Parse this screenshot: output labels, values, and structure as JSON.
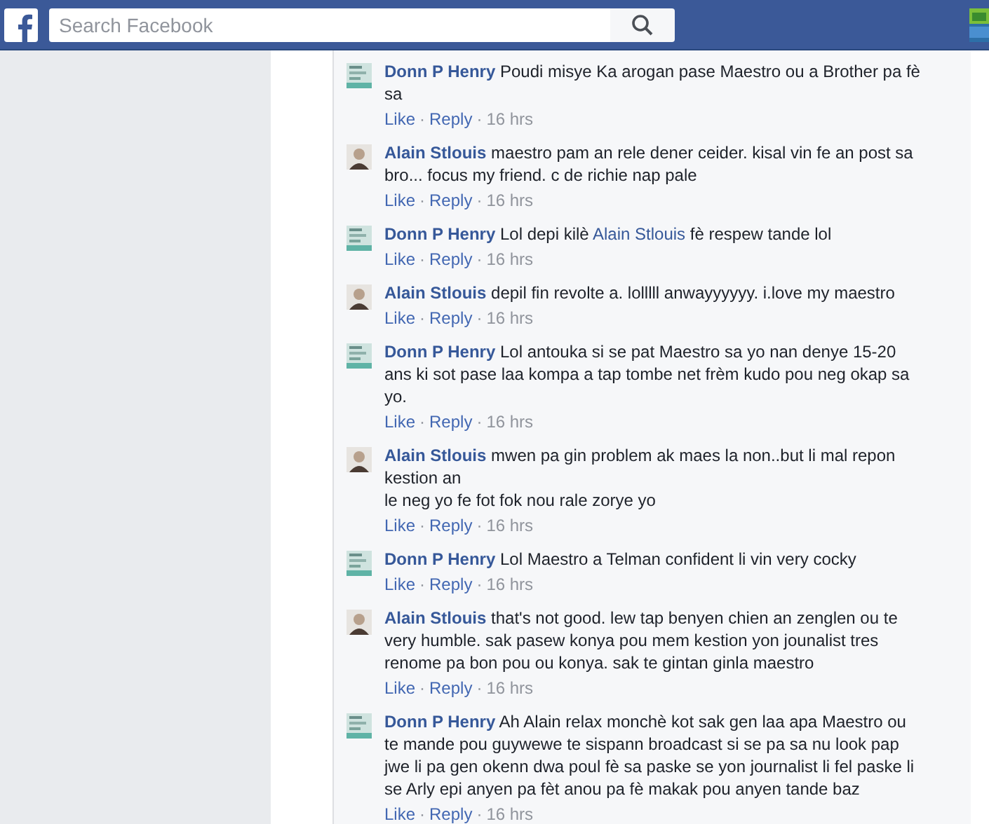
{
  "search": {
    "placeholder": "Search Facebook"
  },
  "separator": "·",
  "comments": [
    {
      "author": "Donn P Henry",
      "kind": "poster",
      "parts": [
        {
          "kind": "text",
          "text": "Poudi misye Ka arogan pase Maestro ou a Brother pa fè sa"
        }
      ],
      "actions": [
        "Like",
        "Reply"
      ],
      "time": "16 hrs"
    },
    {
      "author": "Alain Stlouis",
      "kind": "person",
      "parts": [
        {
          "kind": "text",
          "text": "maestro pam an rele dener ceider. kisal vin fe an post sa bro... focus my friend. c de richie nap pale"
        }
      ],
      "actions": [
        "Like",
        "Reply"
      ],
      "time": "16 hrs"
    },
    {
      "author": "Donn P Henry",
      "kind": "poster",
      "parts": [
        {
          "kind": "text",
          "text": "Lol depi kilè "
        },
        {
          "kind": "mention",
          "text": "Alain Stlouis"
        },
        {
          "kind": "text",
          "text": " fè respew tande lol"
        }
      ],
      "actions": [
        "Like",
        "Reply"
      ],
      "time": "16 hrs"
    },
    {
      "author": "Alain Stlouis",
      "kind": "person",
      "parts": [
        {
          "kind": "text",
          "text": "depil fin revolte a. lolllll anwayyyyyy. i.love my maestro"
        }
      ],
      "actions": [
        "Like",
        "Reply"
      ],
      "time": "16 hrs"
    },
    {
      "author": "Donn P Henry",
      "kind": "poster",
      "parts": [
        {
          "kind": "text",
          "text": "Lol antouka si se pat Maestro sa yo nan denye 15-20 ans ki sot pase laa kompa a tap tombe net frèm kudo pou neg okap sa yo."
        }
      ],
      "actions": [
        "Like",
        "Reply"
      ],
      "time": "16 hrs"
    },
    {
      "author": "Alain Stlouis",
      "kind": "person",
      "parts": [
        {
          "kind": "text",
          "text": "mwen pa gin problem ak maes la non..but li mal repon kestion an\nle neg yo fe fot fok nou rale zorye yo"
        }
      ],
      "actions": [
        "Like",
        "Reply"
      ],
      "time": "16 hrs"
    },
    {
      "author": "Donn P Henry",
      "kind": "poster",
      "parts": [
        {
          "kind": "text",
          "text": "Lol Maestro a Telman confident li vin very cocky"
        }
      ],
      "actions": [
        "Like",
        "Reply"
      ],
      "time": "16 hrs"
    },
    {
      "author": "Alain Stlouis",
      "kind": "person",
      "parts": [
        {
          "kind": "text",
          "text": "that's not good. lew tap benyen chien an zenglen ou te very humble. sak pasew konya pou mem kestion yon jounalist tres renome pa bon pou ou konya. sak te gintan ginla maestro"
        }
      ],
      "actions": [
        "Like",
        "Reply"
      ],
      "time": "16 hrs"
    },
    {
      "author": "Donn P Henry",
      "kind": "poster",
      "parts": [
        {
          "kind": "text",
          "text": "Ah Alain relax monchè kot sak gen laa apa Maestro ou te mande pou guywewe te sispann broadcast si se pa sa nu look pap jwe li pa gen okenn dwa poul fè sa paske se yon journalist li fel paske li se Arly epi anyen pa fèt anou pa fè makak pou anyen tande baz"
        }
      ],
      "actions": [
        "Like",
        "Reply"
      ],
      "time": "16 hrs"
    }
  ]
}
